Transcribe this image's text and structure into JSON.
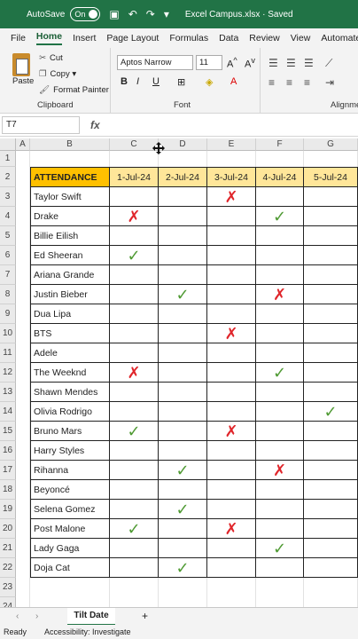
{
  "titlebar": {
    "autosave_label": "AutoSave",
    "autosave_state": "On",
    "file_status": "Excel Campus.xlsx  ·  Saved"
  },
  "menu": [
    "File",
    "Home",
    "Insert",
    "Page Layout",
    "Formulas",
    "Data",
    "Review",
    "View",
    "Automate"
  ],
  "ribbon": {
    "paste": "Paste",
    "cut": "Cut",
    "copy": "Copy",
    "format_painter": "Format Painter",
    "clipboard_label": "Clipboard",
    "font_name": "Aptos Narrow",
    "font_size": "11",
    "font_label": "Font",
    "align_label": "Alignme"
  },
  "formula": {
    "namebox": "T7",
    "fx": "fx"
  },
  "columns": [
    "A",
    "B",
    "C",
    "D",
    "E",
    "F",
    "G"
  ],
  "header_row": [
    "ATTENDANCE",
    "1-Jul-24",
    "2-Jul-24",
    "3-Jul-24",
    "4-Jul-24",
    "5-Jul-24"
  ],
  "rows": [
    {
      "name": "Taylor Swift",
      "marks": [
        "",
        "",
        "x",
        "",
        ""
      ]
    },
    {
      "name": "Drake",
      "marks": [
        "x",
        "",
        "",
        "ok",
        ""
      ]
    },
    {
      "name": "Billie Eilish",
      "marks": [
        "",
        "",
        "",
        "",
        ""
      ]
    },
    {
      "name": "Ed Sheeran",
      "marks": [
        "ok",
        "",
        "",
        "",
        ""
      ]
    },
    {
      "name": "Ariana Grande",
      "marks": [
        "",
        "",
        "",
        "",
        ""
      ]
    },
    {
      "name": "Justin Bieber",
      "marks": [
        "",
        "ok",
        "",
        "x",
        ""
      ]
    },
    {
      "name": "Dua Lipa",
      "marks": [
        "",
        "",
        "",
        "",
        ""
      ]
    },
    {
      "name": "BTS",
      "marks": [
        "",
        "",
        "x",
        "",
        ""
      ]
    },
    {
      "name": "Adele",
      "marks": [
        "",
        "",
        "",
        "",
        ""
      ]
    },
    {
      "name": "The Weeknd",
      "marks": [
        "x",
        "",
        "",
        "ok",
        ""
      ]
    },
    {
      "name": "Shawn Mendes",
      "marks": [
        "",
        "",
        "",
        "",
        ""
      ]
    },
    {
      "name": "Olivia Rodrigo",
      "marks": [
        "",
        "",
        "",
        "",
        "ok"
      ]
    },
    {
      "name": "Bruno Mars",
      "marks": [
        "ok",
        "",
        "x",
        "",
        ""
      ]
    },
    {
      "name": "Harry Styles",
      "marks": [
        "",
        "",
        "",
        "",
        ""
      ]
    },
    {
      "name": "Rihanna",
      "marks": [
        "",
        "ok",
        "",
        "x",
        ""
      ]
    },
    {
      "name": "Beyoncé",
      "marks": [
        "",
        "",
        "",
        "",
        ""
      ]
    },
    {
      "name": "Selena Gomez",
      "marks": [
        "",
        "ok",
        "",
        "",
        ""
      ]
    },
    {
      "name": "Post Malone",
      "marks": [
        "ok",
        "",
        "x",
        "",
        ""
      ]
    },
    {
      "name": "Lady Gaga",
      "marks": [
        "",
        "",
        "",
        "ok",
        ""
      ]
    },
    {
      "name": "Doja Cat",
      "marks": [
        "",
        "ok",
        "",
        "",
        ""
      ]
    }
  ],
  "row_numbers": [
    "1",
    "2",
    "3",
    "4",
    "5",
    "6",
    "7",
    "8",
    "9",
    "10",
    "11",
    "12",
    "13",
    "14",
    "15",
    "16",
    "17",
    "18",
    "19",
    "20",
    "21",
    "22",
    "23",
    "24"
  ],
  "sheet_tab": "Tilt Date",
  "status": {
    "ready": "Ready",
    "accessibility": "Accessibility: Investigate"
  },
  "colors": {
    "brand": "#217346",
    "header_fill": "#ffe699",
    "attendance_fill": "#ffc000",
    "cross": "#e0262b",
    "check": "#4f9a33"
  }
}
